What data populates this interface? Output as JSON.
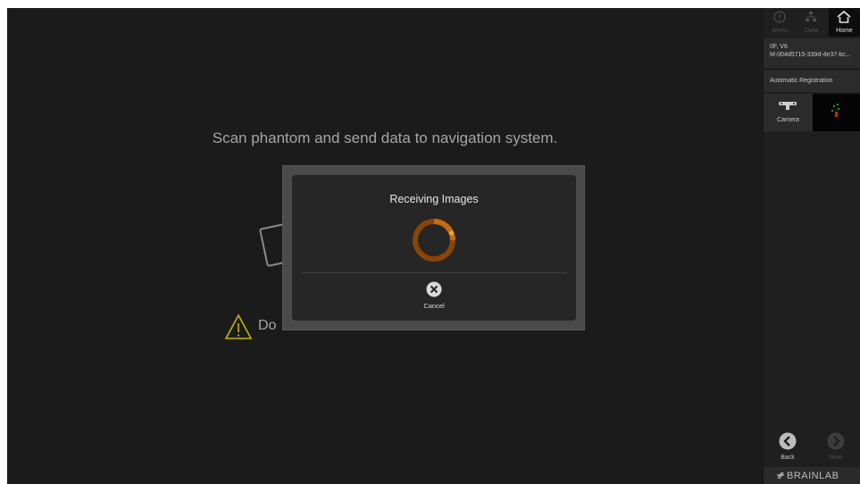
{
  "main": {
    "instruction": "Scan phantom and send data to navigation system.",
    "warning_text": "Do"
  },
  "dialog": {
    "title": "Receiving Images",
    "cancel_label": "Cancel"
  },
  "sidebar": {
    "top_buttons": {
      "alerts": "Alerts",
      "data": "Data",
      "home": "Home"
    },
    "patient": {
      "name": "0F, V6",
      "id": "M-004d5715-339d-4e37-bc..."
    },
    "step": "Automatic Registration",
    "camera_label": "Camera",
    "back_label": "Back",
    "next_label": "Next",
    "brand": "BRAINLAB"
  },
  "icons": {
    "alerts": "alert-circle-icon",
    "data": "data-tree-icon",
    "home": "home-icon",
    "camera": "camera-icon",
    "warning": "warning-triangle-icon",
    "cancel": "cancel-x-icon",
    "back": "back-arrow-icon",
    "next": "next-arrow-icon",
    "spinner": "progress-spinner-icon"
  },
  "colors": {
    "spinner": "#b55a0f",
    "warning": "#c8b400",
    "background": "#1b1b1b"
  }
}
